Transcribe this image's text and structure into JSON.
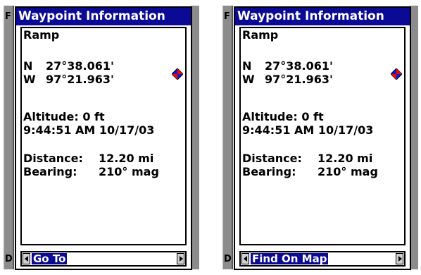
{
  "screens": [
    {
      "bezel_top_glyph": "F",
      "bezel_bottom_glyph": "D",
      "title": "Waypoint Information",
      "waypoint_name": "Ramp",
      "lat_hemisphere": "N",
      "lat_value": "27°38.061'",
      "lon_hemisphere": "W",
      "lon_value": "97°21.963'",
      "altitude": "Altitude: 0 ft",
      "datetime": "9:44:51 AM  10/17/03",
      "distance_label": "Distance:",
      "distance_value": "12.20 mi",
      "bearing_label": "Bearing:",
      "bearing_value": "210° mag",
      "action_label": "Go To"
    },
    {
      "bezel_top_glyph": "F",
      "bezel_bottom_glyph": "D",
      "title": "Waypoint Information",
      "waypoint_name": "Ramp",
      "lat_hemisphere": "N",
      "lat_value": "27°38.061'",
      "lon_hemisphere": "W",
      "lon_value": "97°21.963'",
      "altitude": "Altitude: 0 ft",
      "datetime": "9:44:51 AM  10/17/03",
      "distance_label": "Distance:",
      "distance_value": "12.20 mi",
      "bearing_label": "Bearing:",
      "bearing_value": "210° mag",
      "action_label": "Find On Map"
    }
  ],
  "icons": {
    "waypoint_symbol": "waypoint-diamond-icon",
    "left_arrow": "left-arrow-icon",
    "right_arrow": "right-arrow-icon"
  },
  "colors": {
    "title_bar": "#0a0a94",
    "highlight": "#0a0a94",
    "waypoint_red": "#e01010",
    "waypoint_blue": "#1a1ac8",
    "bezel": "#8c8c8c"
  }
}
